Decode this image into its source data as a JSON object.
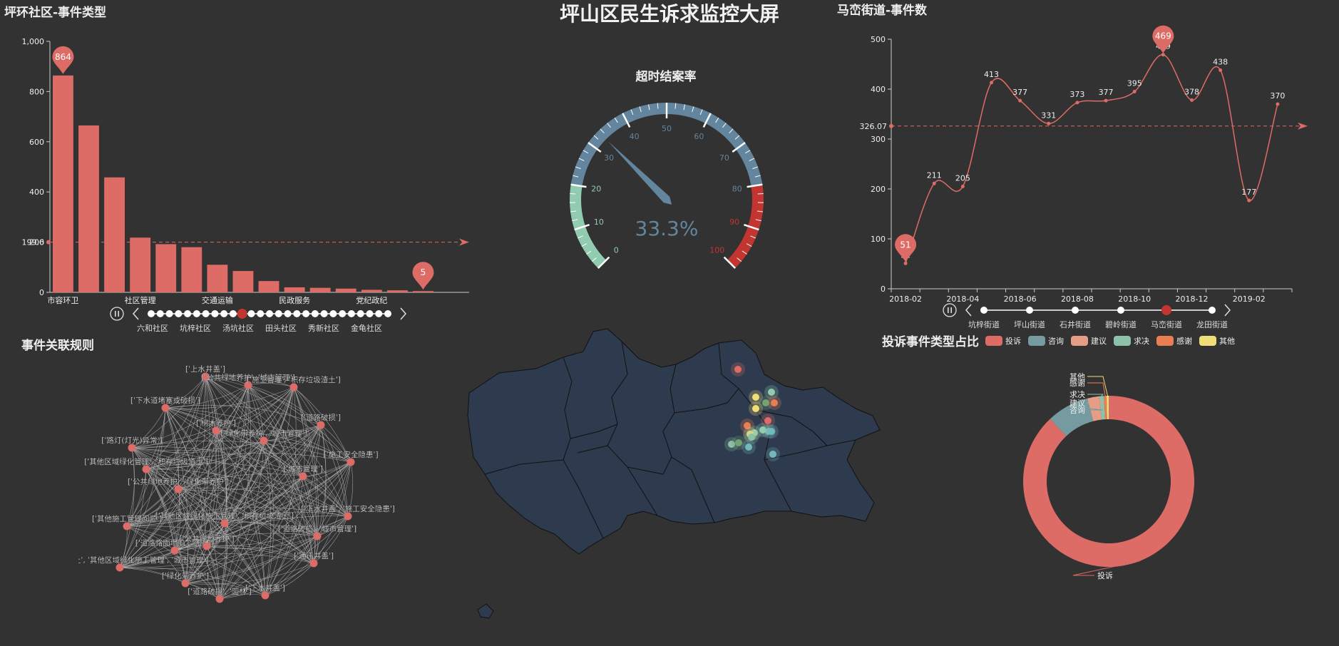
{
  "page_title": "坪山区民生诉求监控大屏",
  "colors": {
    "bg": "#323232",
    "bar": "#dd6b66",
    "gauge_green": "#91cbb0",
    "gauge_blue": "#63859e",
    "gauge_red": "#c23531",
    "map_fill": "#2e3a4d"
  },
  "chart_data": [
    {
      "type": "bar",
      "title": "坪环社区-事件类型",
      "categories": [
        "市容环卫",
        "",
        "",
        "社区管理",
        "",
        "",
        "交通运输",
        "",
        "",
        "民政服务",
        "",
        "",
        "党纪政纪",
        "",
        ""
      ],
      "values": [
        864,
        665,
        458,
        218,
        192,
        180,
        110,
        85,
        45,
        20,
        18,
        15,
        10,
        8,
        5
      ],
      "ylim": [
        0,
        1000
      ],
      "yticks": [
        "0",
        "200",
        "400",
        "600",
        "800",
        "1,000"
      ],
      "mark_points": [
        {
          "label": "864",
          "index": 0
        },
        {
          "label": "5",
          "index": 14
        }
      ],
      "mark_line_label": "199.6",
      "mark_line_value": 200,
      "timeline": {
        "labels": [
          "六和社区",
          "坑梓社区",
          "汤坑社区",
          "田头社区",
          "秀新社区",
          "金龟社区"
        ],
        "count": 27,
        "active_index": 10
      }
    },
    {
      "type": "gauge",
      "title": "超时结案率",
      "value": 33.3,
      "value_label": "33.3%",
      "ticks": [
        "0",
        "10",
        "20",
        "30",
        "40",
        "50",
        "60",
        "70",
        "80",
        "90",
        "100"
      ]
    },
    {
      "type": "line",
      "title": "马峦街道-事件数",
      "x": [
        "2018-02",
        "2018-03",
        "2018-04",
        "2018-05",
        "2018-06",
        "2018-07",
        "2018-08",
        "2018-09",
        "2018-10",
        "2018-11",
        "2018-12",
        "2019-01",
        "2019-02",
        "2019-03"
      ],
      "values": [
        51,
        211,
        205,
        413,
        377,
        331,
        373,
        377,
        395,
        469,
        378,
        438,
        177,
        370
      ],
      "xtick_labels": [
        "2018-02",
        "2018-04",
        "2018-06",
        "2018-08",
        "2018-10",
        "2018-12",
        "2019-02"
      ],
      "ylim": [
        0,
        500
      ],
      "yticks": [
        "0",
        "100",
        "200",
        "300",
        "400",
        "500"
      ],
      "mark_points": [
        {
          "label": "469",
          "index": 9
        },
        {
          "label": "51",
          "index": 0
        }
      ],
      "mark_line_label": "326.07",
      "mark_line_value": 326.07,
      "timeline": {
        "labels": [
          "坑梓街道",
          "坪山街道",
          "石井街道",
          "碧岭街道",
          "马峦街道",
          "龙田街道"
        ],
        "active_index": 4
      }
    },
    {
      "type": "pie",
      "title": "投诉事件类型占比",
      "legend": [
        "投诉",
        "咨询",
        "建议",
        "求决",
        "感谢",
        "其他"
      ],
      "slices": [
        {
          "name": "投诉",
          "value": 88.0,
          "color": "#dd6b66"
        },
        {
          "name": "咨询",
          "value": 8.0,
          "color": "#759aa0"
        },
        {
          "name": "建议",
          "value": 2.2,
          "color": "#e69d87"
        },
        {
          "name": "求决",
          "value": 0.9,
          "color": "#8dc1a9"
        },
        {
          "name": "感谢",
          "value": 0.5,
          "color": "#ea7e53"
        },
        {
          "name": "其他",
          "value": 0.4,
          "color": "#eedd78"
        }
      ]
    },
    {
      "type": "graph",
      "title": "事件关联规则",
      "nodes": [
        "['上水井盖']",
        "['公共绿地养护', '城市管理']",
        "['施工管理', '积存垃圾渣土']",
        "['下水道堵塞或破损']",
        "['道路破损']",
        "['树木养护']",
        "['绿化带养护', '城市管理']",
        "['路灯(灯光)异常']",
        "['其他区域绿化管理', '积存垃圾渣土']",
        "['施工安全隐患']",
        "['公共绿地养护', '绿化带养护']",
        "['城市管理']",
        "['其他施工管理问题']",
        "['其他区域绿化施工管理', '积存垃圾渣土']",
        "['道路路面塌陷', '园林']",
        "['下水井盖', '施工安全隐患']",
        "['道路破损', '城市管理']",
        "['积存垃圾渣土', '其他区域绿化施工管理', '城市管理']",
        "['公共绿地养护']",
        "['通讯井盖']",
        "['绿化带养护']",
        "['道路破损', '园林']",
        "['下水井盖']"
      ]
    },
    {
      "type": "map",
      "points": [
        {
          "color": "#dd6b66"
        },
        {
          "color": "#eedd78"
        },
        {
          "color": "#91cbb0"
        },
        {
          "color": "#73a373"
        },
        {
          "color": "#ea7e53"
        },
        {
          "color": "#eedd78"
        },
        {
          "color": "#dd6b66"
        },
        {
          "color": "#ea7e53"
        },
        {
          "color": "#73b9bc"
        },
        {
          "color": "#91cbb0"
        },
        {
          "color": "#8dc1a9"
        },
        {
          "color": "#91cbb0"
        },
        {
          "color": "#eedd78"
        },
        {
          "color": "#73a373"
        },
        {
          "color": "#73b9bc"
        },
        {
          "color": "#73b9bc"
        },
        {
          "color": "#73b9bc"
        },
        {
          "color": "#8dc1a9"
        }
      ]
    }
  ]
}
